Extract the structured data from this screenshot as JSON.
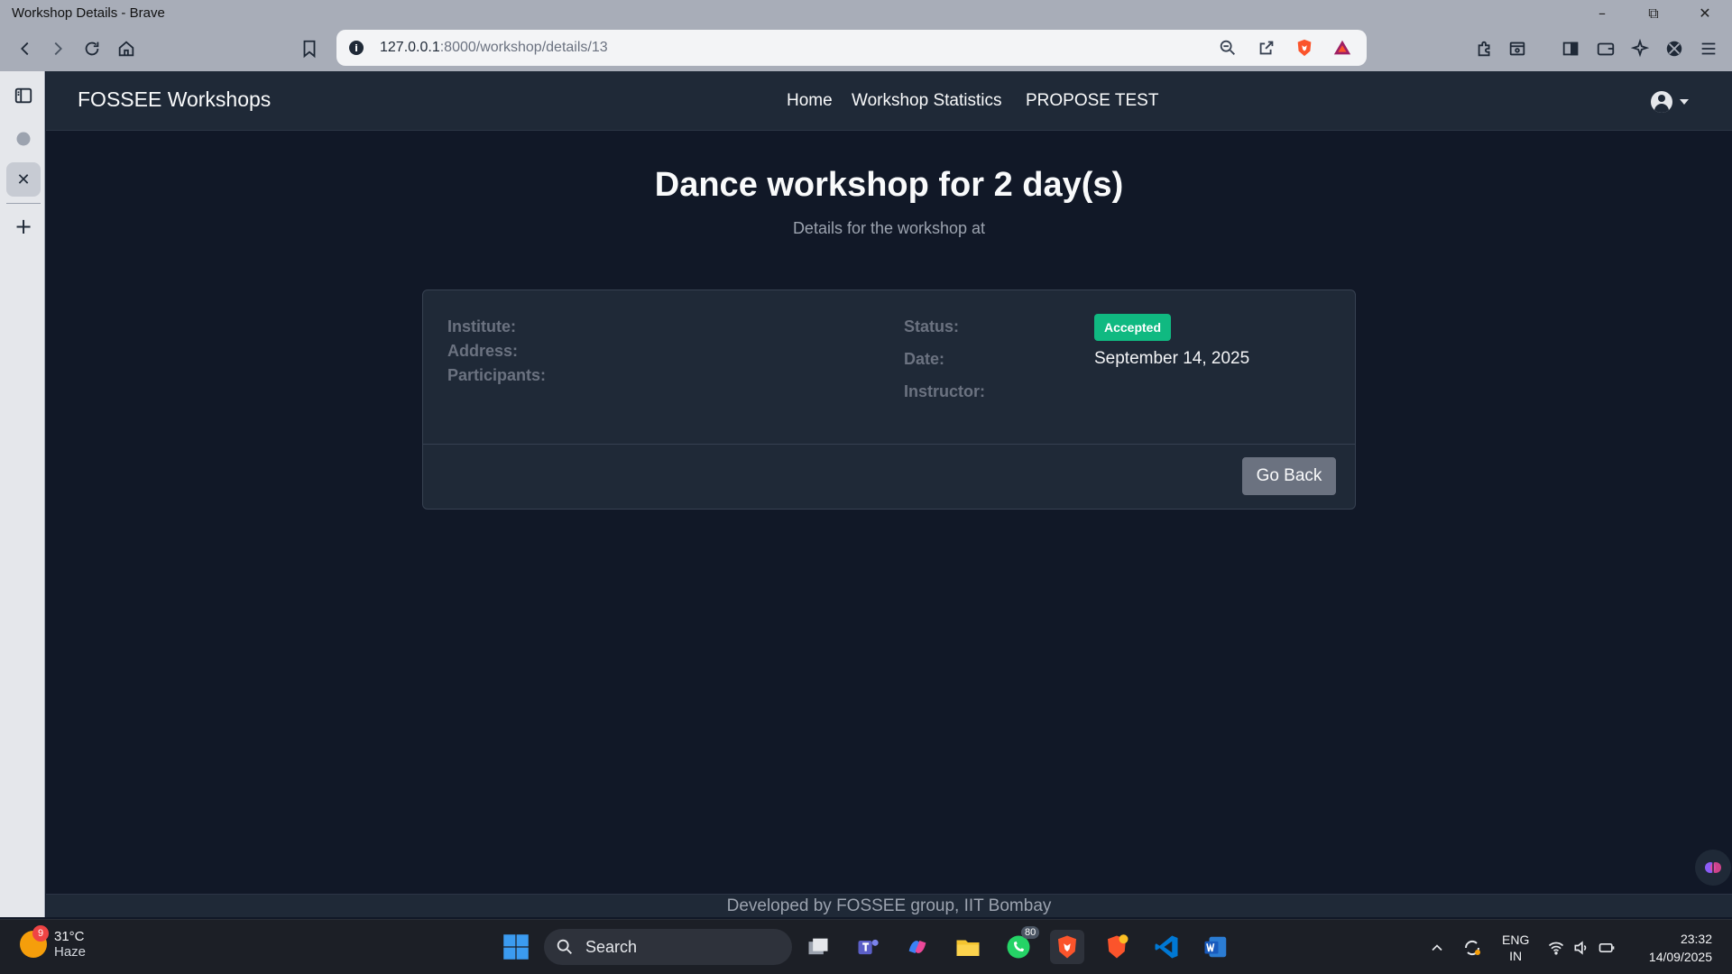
{
  "window": {
    "title": "Workshop Details - Brave",
    "controls": {
      "minimize": "–",
      "maximize": "⧉",
      "close": "✕"
    }
  },
  "toolbar": {
    "url_host": "127.0.0.1",
    "url_rest": ":8000/workshop/details/13",
    "info_glyph": "i"
  },
  "sidepanel": {
    "close_glyph": "✕",
    "add_glyph": "+"
  },
  "site": {
    "brand": "FOSSEE Workshops",
    "nav": [
      "Home",
      "Workshop Statistics",
      "PROPOSE TEST"
    ]
  },
  "workshop": {
    "heading": "Dance workshop for 2 day(s)",
    "subheading": "Details for the workshop at",
    "labels": {
      "institute": "Institute:",
      "address": "Address:",
      "participants": "Participants:",
      "status": "Status:",
      "date": "Date:",
      "instructor": "Instructor:"
    },
    "status": "Accepted",
    "date": "September 14, 2025",
    "go_back": "Go Back"
  },
  "footer": {
    "text": "Developed by FOSSEE group, IIT Bombay"
  },
  "taskbar": {
    "weather_badge": "9",
    "temperature": "31°C",
    "condition": "Haze",
    "search": "Search",
    "whatsapp_badge": "80",
    "lang_line1": "ENG",
    "lang_line2": "IN",
    "time": "23:32",
    "date": "14/09/2025"
  },
  "colors": {
    "status_badge": "#10b981",
    "page_bg": "#111827",
    "navbar_bg": "#1f2937"
  }
}
